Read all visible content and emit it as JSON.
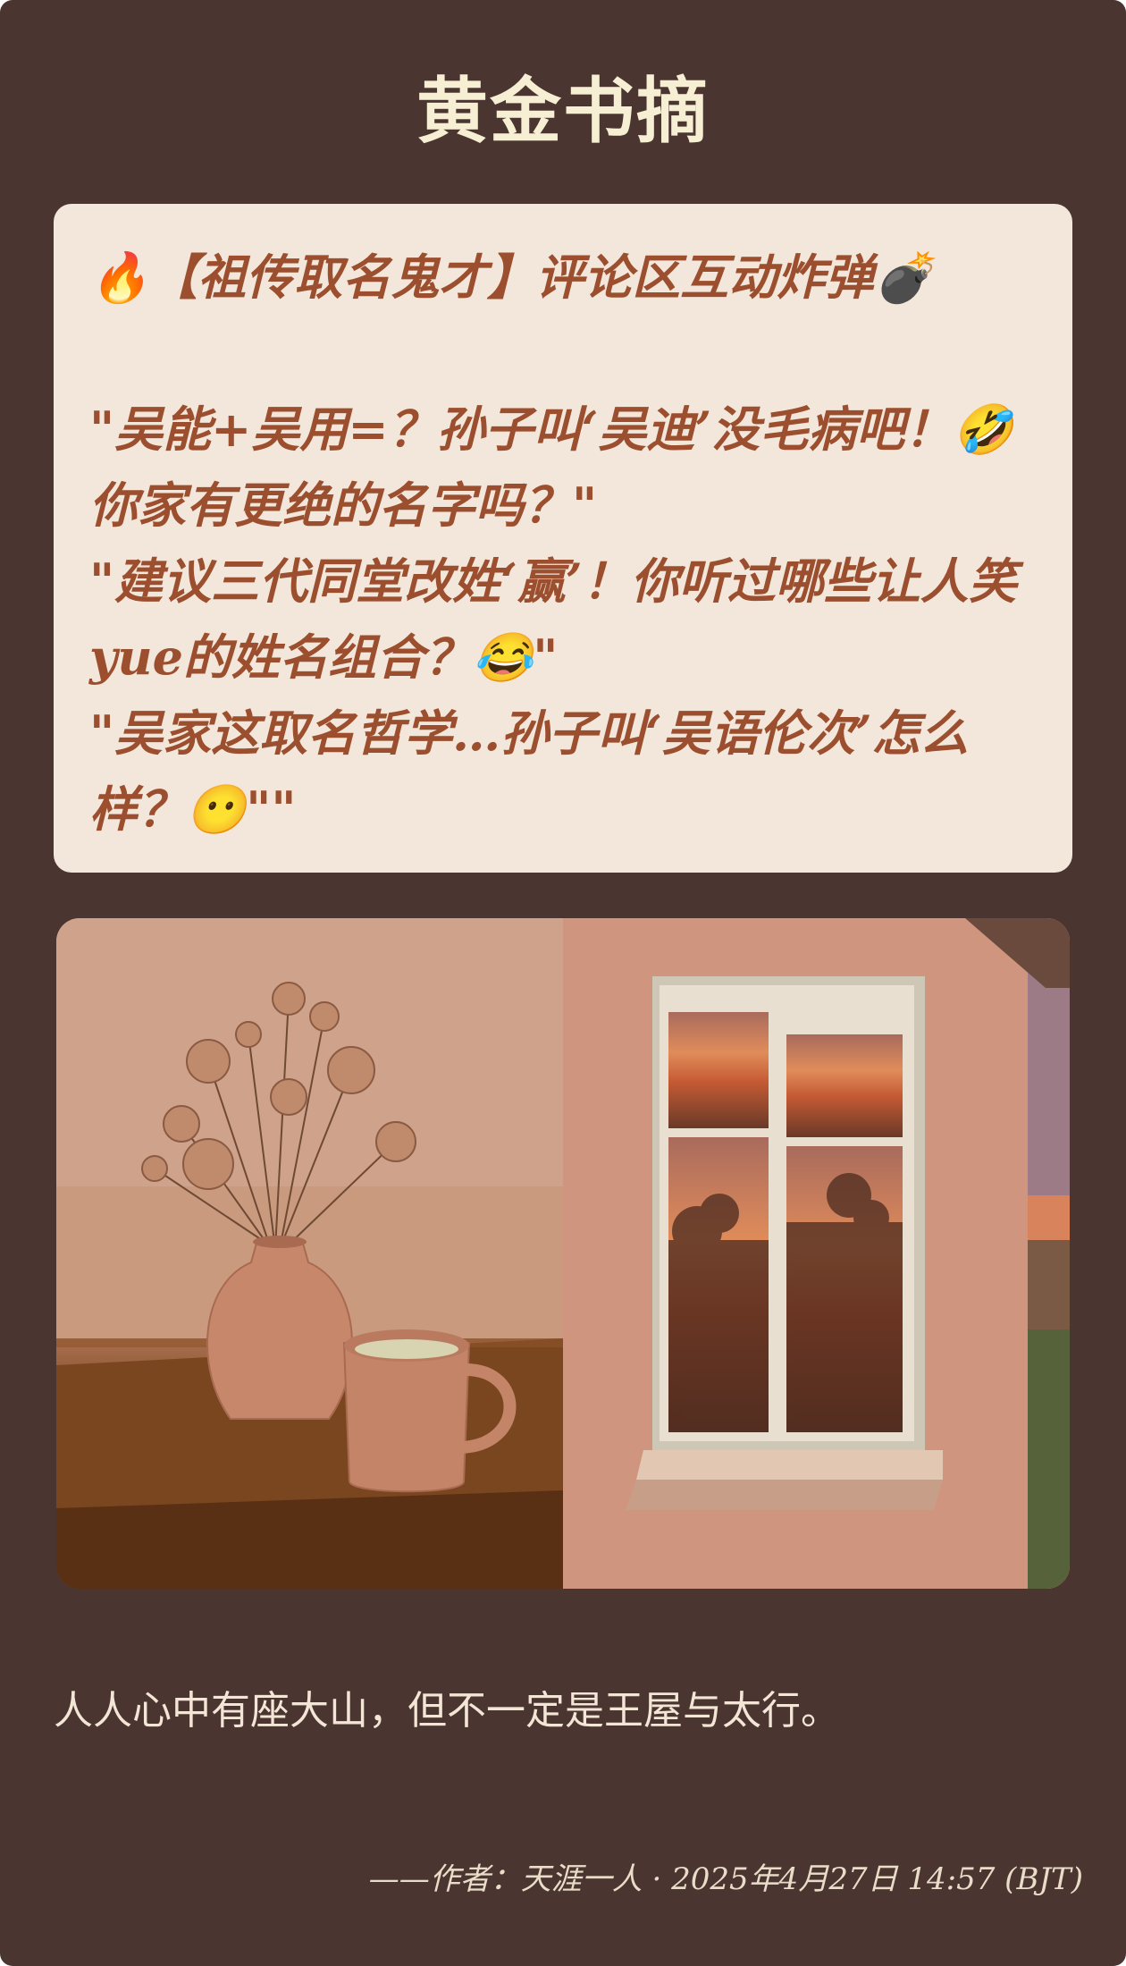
{
  "header": {
    "title": "黄金书摘"
  },
  "quote": {
    "text": "🔥【祖传取名鬼才】评论区互动炸弹💣\n\n\"吴能+吴用=？孙子叫‘吴迪’没毛病吧！🤣 你家有更绝的名字吗？\"\n\"建议三代同堂改姓‘赢’！你听过哪些让人笑yue的姓名组合？😂\"\n\"吴家这取名哲学…孙子叫‘吴语伦次’怎么样？😶\"\""
  },
  "photos": [
    {
      "subject": "dried-flowers-vase-and-mug"
    },
    {
      "subject": "window-at-sunset"
    }
  ],
  "caption": {
    "text": "人人心中有座大山，但不一定是王屋与太行。"
  },
  "byline": {
    "text": "——作者：天涯一人 · 2025年4月27日 14:57 (BJT)"
  },
  "colors": {
    "background": "#4a3530",
    "quote_box": "#f3e7dc",
    "quote_text": "#9c4f2e",
    "title": "#f7efd3",
    "caption": "#f3e6d6"
  }
}
